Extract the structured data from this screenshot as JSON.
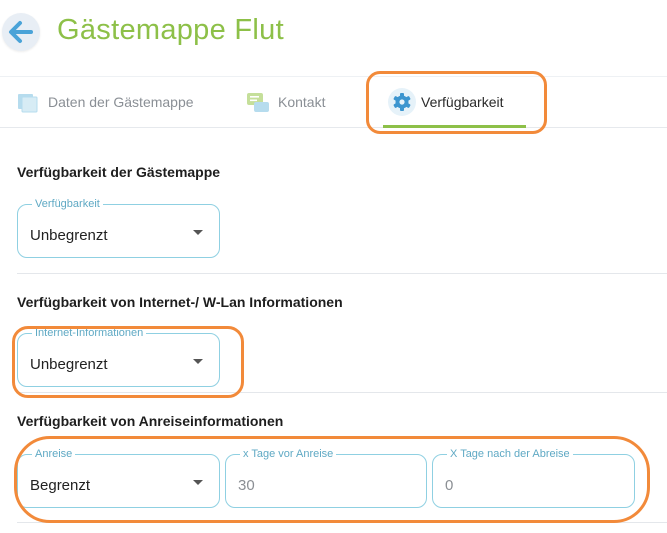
{
  "header": {
    "title": "Gästemappe Flut",
    "back_icon": "arrow-left-icon"
  },
  "tabs": [
    {
      "label": "Daten der Gästemappe",
      "icon": "document-icon",
      "active": false
    },
    {
      "label": "Kontakt",
      "icon": "chat-icon",
      "active": false
    },
    {
      "label": "Verfügbarkeit",
      "icon": "gear-icon",
      "active": true
    }
  ],
  "sections": {
    "guestbook": {
      "title": "Verfügbarkeit der Gästemappe",
      "field": {
        "label": "Verfügbarkeit",
        "value": "Unbegrenzt"
      }
    },
    "internet": {
      "title": "Verfügbarkeit von Internet-/ W-Lan Informationen",
      "field": {
        "label": "Internet-Informationen",
        "value": "Unbegrenzt"
      }
    },
    "arrival": {
      "title": "Verfügbarkeit von Anreiseinformationen",
      "select": {
        "label": "Anreise",
        "value": "Begrenzt"
      },
      "days_before": {
        "label": "x Tage vor Anreise",
        "value": "30"
      },
      "days_after": {
        "label": "X Tage nach der Abreise",
        "value": "0"
      }
    }
  },
  "colors": {
    "accent": "#8dc048",
    "field_border": "#8fd0e2",
    "highlight": "#f28a3a"
  }
}
